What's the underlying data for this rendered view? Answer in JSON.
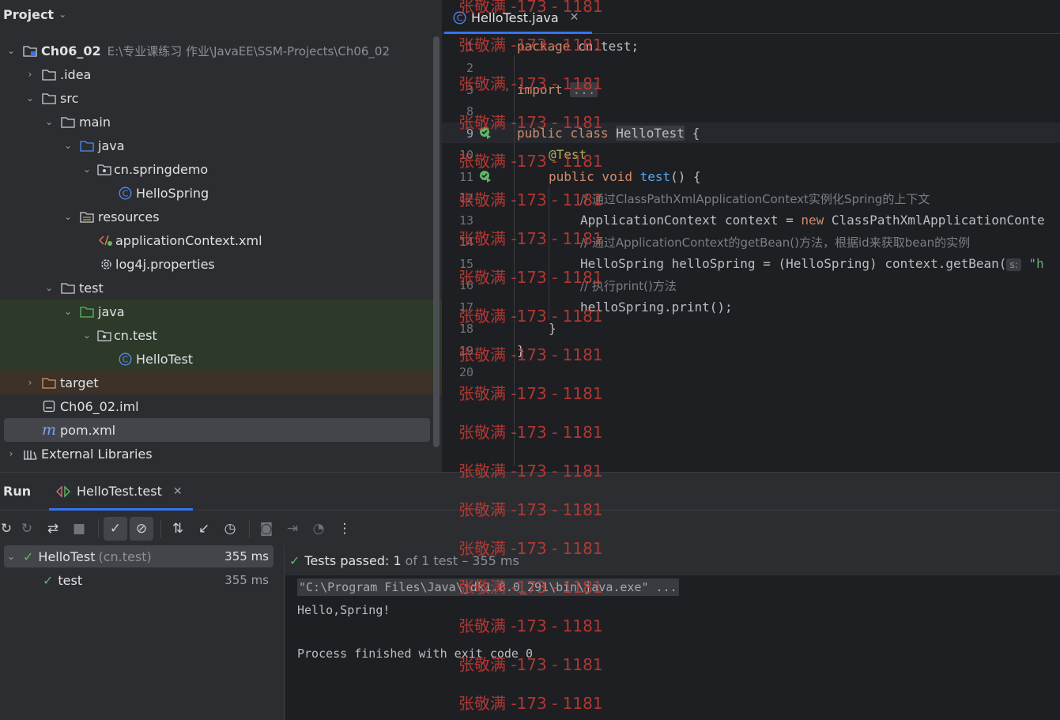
{
  "project": {
    "title": "Project",
    "tree": [
      {
        "label": "Ch06_02",
        "path": "E:\\专业课练习 作业\\JavaEE\\SSM-Projects\\Ch06_02"
      },
      {
        "label": ".idea"
      },
      {
        "label": "src"
      },
      {
        "label": "main"
      },
      {
        "label": "java"
      },
      {
        "label": "cn.springdemo"
      },
      {
        "label": "HelloSpring"
      },
      {
        "label": "resources"
      },
      {
        "label": "applicationContext.xml"
      },
      {
        "label": "log4j.properties"
      },
      {
        "label": "test"
      },
      {
        "label": "java"
      },
      {
        "label": "cn.test"
      },
      {
        "label": "HelloTest"
      },
      {
        "label": "target"
      },
      {
        "label": "Ch06_02.iml"
      },
      {
        "label": "pom.xml"
      },
      {
        "label": "External Libraries"
      }
    ]
  },
  "editor": {
    "tab": "HelloTest.java",
    "line_numbers": [
      "1",
      "2",
      "3",
      "8",
      "9",
      "10",
      "11",
      "12",
      "13",
      "14",
      "15",
      "16",
      "17",
      "18",
      "19",
      "20"
    ],
    "code": {
      "l1_kw": "package",
      "l1_rest": " cn.test;",
      "l3_kw": "import",
      "l3_fold": "...",
      "l9_kw": "public class",
      "l9_name": "HelloTest",
      "l9_rest": " {",
      "l10_ann": "@Test",
      "l11_kw": "public void",
      "l11_fn": "test",
      "l11_rest": "() {",
      "l12_comment": "// 通过ClassPathXmlApplicationContext实例化Spring的上下文",
      "l13_a": "ApplicationContext context = ",
      "l13_kw": "new",
      "l13_b": " ClassPathXmlApplicationConte",
      "l14_comment": "// 通过ApplicationContext的getBean()方法，根据id来获取bean的实例",
      "l15_a": "HelloSpring helloSpring = (HelloSpring) context.getBean(",
      "l15_hint": "s:",
      "l15_str": " \"h",
      "l16_comment": "// 执行print()方法",
      "l17": "helloSpring.print();",
      "l18": "}",
      "l19": "}"
    }
  },
  "watermark": "张敬满 -173 - 1181",
  "run": {
    "title": "Run",
    "tab": "HelloTest.test",
    "tree": {
      "root_label": "HelloTest",
      "root_pkg": "(cn.test)",
      "root_time": "355 ms",
      "child_label": "test",
      "child_time": "355 ms"
    },
    "status": {
      "passed_label": "Tests passed: 1",
      "detail": "of 1 test – 355 ms"
    },
    "console": {
      "cmd": "\"C:\\Program Files\\Java\\jdk1.8.0_291\\bin\\java.exe\" ...",
      "output": "Hello,Spring!",
      "exit": "Process finished with exit code 0"
    }
  },
  "colors": {
    "accent": "#3574f0",
    "pass": "#5fb865",
    "watermark": "#c53b36"
  }
}
